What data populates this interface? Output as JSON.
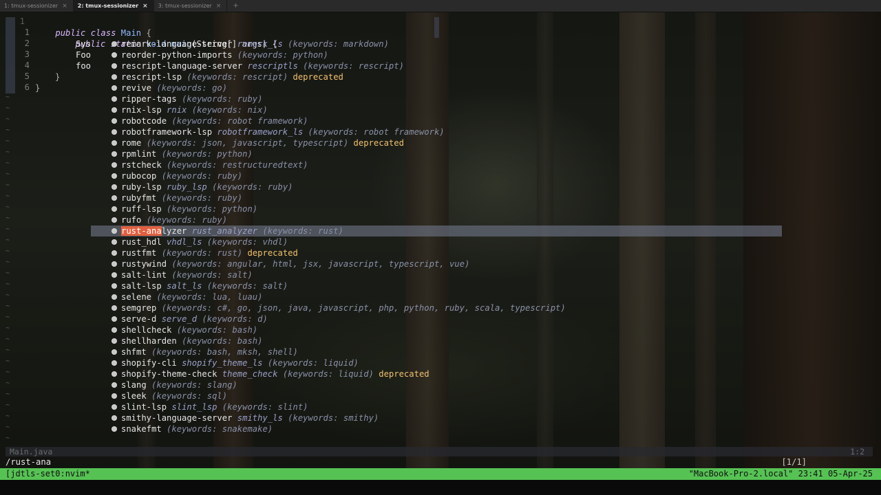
{
  "tabs": [
    {
      "label": "1: tmux-sessionizer",
      "close": "×",
      "active": false
    },
    {
      "label": "2: tmux-sessionizer",
      "close": "×",
      "active": true
    },
    {
      "label": "3: tmux-sessionizer",
      "close": "×",
      "active": false
    }
  ],
  "tab_add": "+",
  "editor": {
    "line_numbers": [
      "1",
      "1",
      "2",
      "3",
      "4",
      "5",
      "6"
    ],
    "code": {
      "l0_kw": "public",
      "l0_kw2": "class",
      "l0_name": "Main",
      "l0_brace": "{",
      "l1_kw": "public",
      "l1_kw2": "static",
      "l1_type": "void",
      "l1_fn": "main",
      "l1_args": "(String[] args) {",
      "l2_frag": "Sys",
      "l3_frag": "Foo",
      "l4_frag": "foo",
      "l5_brace": "}",
      "l6_brace": "}"
    },
    "tilde": "~"
  },
  "picker": {
    "selected_index": 17,
    "match_prefix": "rust-ana",
    "items": [
      {
        "name": "remark-language-server",
        "alias": "remark_ls",
        "keywords": "(keywords: markdown)",
        "deprecated": ""
      },
      {
        "name": "reorder-python-imports",
        "alias": "",
        "keywords": "(keywords: python)",
        "deprecated": ""
      },
      {
        "name": "rescript-language-server",
        "alias": "rescriptls",
        "keywords": "(keywords: rescript)",
        "deprecated": ""
      },
      {
        "name": "rescript-lsp",
        "alias": "",
        "keywords": "(keywords: rescript)",
        "deprecated": "deprecated"
      },
      {
        "name": "revive",
        "alias": "",
        "keywords": "(keywords: go)",
        "deprecated": ""
      },
      {
        "name": "ripper-tags",
        "alias": "",
        "keywords": "(keywords: ruby)",
        "deprecated": ""
      },
      {
        "name": "rnix-lsp",
        "alias": "rnix",
        "keywords": "(keywords: nix)",
        "deprecated": ""
      },
      {
        "name": "robotcode",
        "alias": "",
        "keywords": "(keywords: robot framework)",
        "deprecated": ""
      },
      {
        "name": "robotframework-lsp",
        "alias": "robotframework_ls",
        "keywords": "(keywords: robot framework)",
        "deprecated": ""
      },
      {
        "name": "rome",
        "alias": "",
        "keywords": "(keywords: json, javascript, typescript)",
        "deprecated": "deprecated"
      },
      {
        "name": "rpmlint",
        "alias": "",
        "keywords": "(keywords: python)",
        "deprecated": ""
      },
      {
        "name": "rstcheck",
        "alias": "",
        "keywords": "(keywords: restructuredtext)",
        "deprecated": ""
      },
      {
        "name": "rubocop",
        "alias": "",
        "keywords": "(keywords: ruby)",
        "deprecated": ""
      },
      {
        "name": "ruby-lsp",
        "alias": "ruby_lsp",
        "keywords": "(keywords: ruby)",
        "deprecated": ""
      },
      {
        "name": "rubyfmt",
        "alias": "",
        "keywords": "(keywords: ruby)",
        "deprecated": ""
      },
      {
        "name": "ruff-lsp",
        "alias": "",
        "keywords": "(keywords: python)",
        "deprecated": ""
      },
      {
        "name": "rufo",
        "alias": "",
        "keywords": "(keywords: ruby)",
        "deprecated": ""
      },
      {
        "name": "rust-analyzer",
        "alias": "rust_analyzer",
        "keywords": "(keywords: rust)",
        "deprecated": ""
      },
      {
        "name": "rust_hdl",
        "alias": "vhdl_ls",
        "keywords": "(keywords: vhdl)",
        "deprecated": ""
      },
      {
        "name": "rustfmt",
        "alias": "",
        "keywords": "(keywords: rust)",
        "deprecated": "deprecated"
      },
      {
        "name": "rustywind",
        "alias": "",
        "keywords": "(keywords: angular, html, jsx, javascript, typescript, vue)",
        "deprecated": ""
      },
      {
        "name": "salt-lint",
        "alias": "",
        "keywords": "(keywords: salt)",
        "deprecated": ""
      },
      {
        "name": "salt-lsp",
        "alias": "salt_ls",
        "keywords": "(keywords: salt)",
        "deprecated": ""
      },
      {
        "name": "selene",
        "alias": "",
        "keywords": "(keywords: lua, luau)",
        "deprecated": ""
      },
      {
        "name": "semgrep",
        "alias": "",
        "keywords": "(keywords: c#, go, json, java, javascript, php, python, ruby, scala, typescript)",
        "deprecated": ""
      },
      {
        "name": "serve-d",
        "alias": "serve_d",
        "keywords": "(keywords: d)",
        "deprecated": ""
      },
      {
        "name": "shellcheck",
        "alias": "",
        "keywords": "(keywords: bash)",
        "deprecated": ""
      },
      {
        "name": "shellharden",
        "alias": "",
        "keywords": "(keywords: bash)",
        "deprecated": ""
      },
      {
        "name": "shfmt",
        "alias": "",
        "keywords": "(keywords: bash, mksh, shell)",
        "deprecated": ""
      },
      {
        "name": "shopify-cli",
        "alias": "shopify_theme_ls",
        "keywords": "(keywords: liquid)",
        "deprecated": ""
      },
      {
        "name": "shopify-theme-check",
        "alias": "theme_check",
        "keywords": "(keywords: liquid)",
        "deprecated": "deprecated"
      },
      {
        "name": "slang",
        "alias": "",
        "keywords": "(keywords: slang)",
        "deprecated": ""
      },
      {
        "name": "sleek",
        "alias": "",
        "keywords": "(keywords: sql)",
        "deprecated": ""
      },
      {
        "name": "slint-lsp",
        "alias": "slint_lsp",
        "keywords": "(keywords: slint)",
        "deprecated": ""
      },
      {
        "name": "smithy-language-server",
        "alias": "smithy_ls",
        "keywords": "(keywords: smithy)",
        "deprecated": ""
      },
      {
        "name": "snakefmt",
        "alias": "",
        "keywords": "(keywords: snakemake)",
        "deprecated": ""
      }
    ]
  },
  "statusline": {
    "file": "Main.java",
    "position": "1:2"
  },
  "cmdline": {
    "text": "/rust-ana",
    "count": "[1/1]"
  },
  "tmux": {
    "left": "[jdtls-set0:nvim*",
    "right": "\"MacBook-Pro-2.local\" 23:41 05-Apr-25"
  },
  "colors": {
    "tmux_status": "#56c254",
    "match_highlight": "#e06040",
    "deprecated": "#f0c070"
  }
}
